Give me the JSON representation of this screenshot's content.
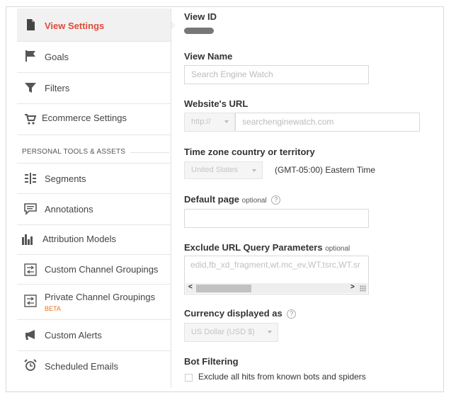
{
  "sidebar": {
    "items": [
      {
        "label": "View Settings",
        "icon": "document-icon",
        "active": true
      },
      {
        "label": "Goals",
        "icon": "flag-icon"
      },
      {
        "label": "Filters",
        "icon": "funnel-icon"
      },
      {
        "label": "Ecommerce Settings",
        "icon": "cart-icon"
      }
    ],
    "section_header": "PERSONAL TOOLS & ASSETS",
    "tools": [
      {
        "label": "Segments",
        "icon": "segments-icon"
      },
      {
        "label": "Annotations",
        "icon": "comment-icon"
      },
      {
        "label": "Attribution Models",
        "icon": "bar-chart-icon"
      },
      {
        "label": "Custom Channel Groupings",
        "icon": "channel-grouping-icon"
      },
      {
        "label": "Private Channel Groupings",
        "badge": "BETA",
        "icon": "channel-grouping-icon"
      },
      {
        "label": "Custom Alerts",
        "icon": "megaphone-icon"
      },
      {
        "label": "Scheduled Emails",
        "icon": "alarm-clock-icon"
      }
    ]
  },
  "form": {
    "view_id_label": "View ID",
    "view_name_label": "View Name",
    "view_name_placeholder": "Search Engine Watch",
    "website_url_label": "Website's URL",
    "protocol_value": "http://",
    "website_url_placeholder": "searchenginewatch.com",
    "timezone_label": "Time zone country or territory",
    "timezone_country": "United States",
    "timezone_value": "(GMT-05:00) Eastern Time",
    "default_page_label": "Default page",
    "optional_text": "optional",
    "help_glyph": "?",
    "exclude_params_label": "Exclude URL Query Parameters",
    "exclude_params_value": "edid,fb_xd_fragment,wt.mc_ev,WT.tsrc,WT.sr",
    "currency_label": "Currency displayed as",
    "currency_value": "US Dollar (USD $)",
    "bot_filtering_label": "Bot Filtering",
    "bot_filtering_checkbox_label": "Exclude all hits from known bots and spiders"
  },
  "colors": {
    "active_accent": "#dd4b39",
    "beta_orange": "#e8711c"
  }
}
